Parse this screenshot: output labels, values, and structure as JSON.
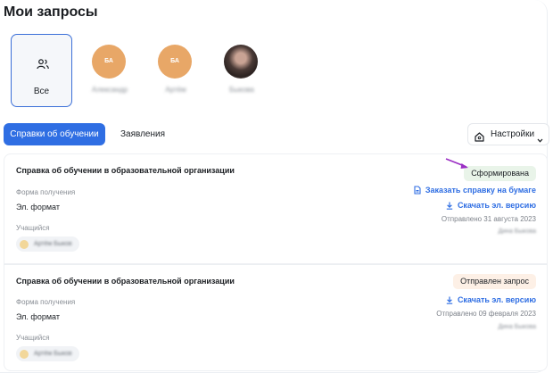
{
  "page": {
    "title": "Мои запросы"
  },
  "people": [
    {
      "label": "Все",
      "kind": "all"
    },
    {
      "initials": "БА",
      "name": "Александр"
    },
    {
      "initials": "БА",
      "name": "Артём"
    },
    {
      "name": "Быкова",
      "kind": "photo"
    }
  ],
  "tabs": {
    "primary": "Справки об обучении",
    "secondary": "Заявления",
    "settings": "Настройки"
  },
  "requests": [
    {
      "title": "Справка об обучении в образовательной организации",
      "status": "Сформирована",
      "status_color": "#e9f4e9",
      "form_label": "Форма получения",
      "form_value": "Эл. формат",
      "student_label": "Учащийся",
      "student_name": "Артём Быков",
      "order_paper": "Заказать справку на бумаге",
      "download": "Скачать эл. версию",
      "sent": "Отправлено 31 августа 2023",
      "signer": "Дина Быкова"
    },
    {
      "title": "Справка об обучении в образовательной организации",
      "status": "Отправлен запрос",
      "status_color": "#fdf0e6",
      "form_label": "Форма получения",
      "form_value": "Эл. формат",
      "student_label": "Учащийся",
      "student_name": "Артём Быков",
      "download": "Скачать эл. версию",
      "sent": "Отправлено 09 февраля 2023",
      "signer": "Дина Быкова"
    }
  ],
  "colors": {
    "accent": "#2f6ee3",
    "avatar": "#e8a767",
    "annotation_arrow": "#9b2fc4"
  },
  "icons": [
    "people-icon",
    "house-icon",
    "chevron-down-icon",
    "document-icon",
    "download-icon",
    "annotation-arrow-icon"
  ]
}
